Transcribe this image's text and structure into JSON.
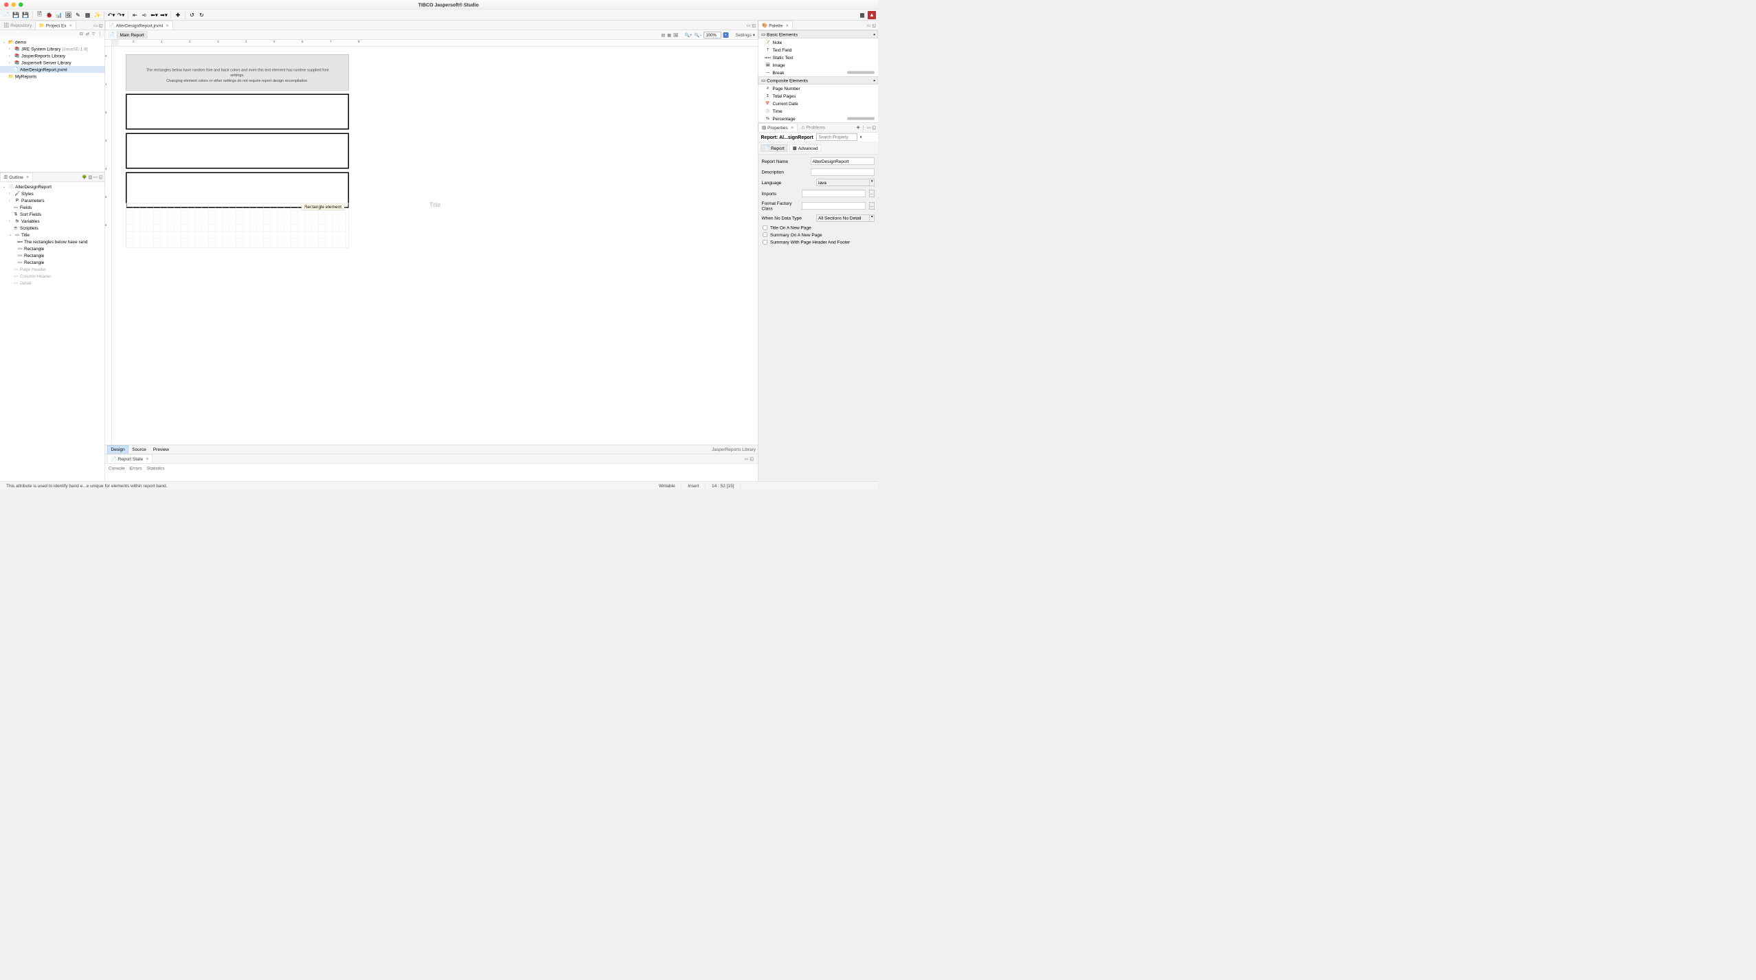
{
  "window": {
    "title": "TIBCO Jaspersoft® Studio"
  },
  "left_tabs": {
    "repository": "Repository",
    "project": "Project Ex"
  },
  "project_tree": {
    "root": "demo",
    "children": [
      {
        "label": "JRE System Library",
        "suffix": "[JavaSE-1.8]"
      },
      {
        "label": "JasperReports Library",
        "suffix": ""
      },
      {
        "label": "Jaspersoft Server Library",
        "suffix": ""
      },
      {
        "label": "AlterDesignReport.jrxml",
        "suffix": ""
      }
    ],
    "sibling": "MyReports"
  },
  "outline": {
    "title": "Outline",
    "root": "AlterDesignReport",
    "items": [
      {
        "label": "Styles",
        "twisty": "›"
      },
      {
        "label": "Parameters",
        "twisty": "›"
      },
      {
        "label": "Fields",
        "twisty": ""
      },
      {
        "label": "Sort Fields",
        "twisty": ""
      },
      {
        "label": "Variables",
        "twisty": "›"
      },
      {
        "label": "Scriptlets",
        "twisty": ""
      },
      {
        "label": "Title",
        "twisty": "⌄",
        "children": [
          "The rectangles below have rand",
          "Rectangle",
          "Rectangle",
          "Rectangle"
        ]
      },
      {
        "label": "Page Header",
        "dim": true
      },
      {
        "label": "Column Header",
        "dim": true
      },
      {
        "label": "Detail",
        "dim": true
      }
    ]
  },
  "editor": {
    "tab": "AlterDesignReport.jrxml",
    "main_report": "Main Report",
    "zoom": "100%",
    "settings": "Settings",
    "ruler_h": [
      "0",
      "1",
      "2",
      "3",
      "4",
      "5",
      "6",
      "7",
      "8"
    ],
    "ruler_v": [
      "0",
      "1",
      "2",
      "3",
      "4",
      "5",
      "6"
    ],
    "header_text1": "The rectangles below have random fore and back colors and even this text element has runtime supplied font settings.",
    "header_text2": "Changing element colors or other settings do not require report design recompilation.",
    "tooltip": "Rectangle element",
    "title_watermark": "Title",
    "bottom_tabs": {
      "design": "Design",
      "source": "Source",
      "preview": "Preview"
    },
    "lib_label": "JasperReports Library"
  },
  "report_state": {
    "title": "Report State",
    "subtabs": [
      "Console",
      "Errors",
      "Statistics"
    ]
  },
  "palette": {
    "title": "Palette",
    "section1": "Basic Elements",
    "items1": [
      "Note",
      "Text Field",
      "Static Text",
      "Image",
      "Break"
    ],
    "section2": "Composite Elements",
    "items2": [
      "Page Number",
      "Total Pages",
      "Current Date",
      "Time",
      "Percentage"
    ]
  },
  "properties": {
    "tab": "Properties",
    "problems_tab": "Problems",
    "title": "Report: Al...signReport",
    "search_placeholder": "Search Property",
    "subtabs": {
      "report": "Report",
      "advanced": "Advanced"
    },
    "fields": {
      "report_name": {
        "label": "Report Name",
        "value": "AlterDesignReport"
      },
      "description": {
        "label": "Description",
        "value": ""
      },
      "language": {
        "label": "Language",
        "value": "iava"
      },
      "imports": {
        "label": "Imports",
        "value": ""
      },
      "format_factory": {
        "label": "Format Factory Class",
        "value": ""
      },
      "no_data": {
        "label": "When No Data Type",
        "value": "All Sections No Detail"
      }
    },
    "checks": [
      "Title On A New Page",
      "Summary On A New Page",
      "Summary With Page Header And Footer"
    ]
  },
  "statusbar": {
    "hint": "This attribute is used to identify band e...e unique for elements within report band.",
    "writable": "Writable",
    "insert": "Insert",
    "position": "14 : 52 [15]"
  }
}
